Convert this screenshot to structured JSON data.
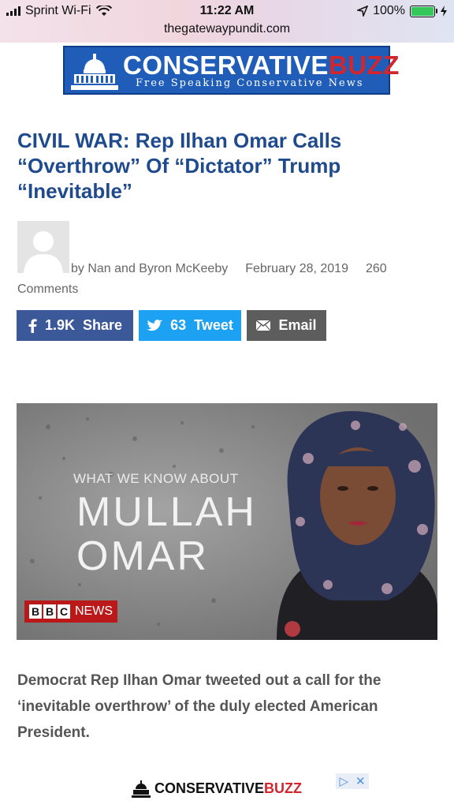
{
  "status_bar": {
    "carrier": "Sprint Wi-Fi",
    "time": "11:22 AM",
    "battery": "100%",
    "battery_level": 1.0
  },
  "url_bar": {
    "url": "thegatewaypundit.com"
  },
  "banner": {
    "title_main": "CONSERVATIVE",
    "title_accent": "BUZZ",
    "subtitle": "Free Speaking Conservative News"
  },
  "article": {
    "headline": "CIVIL WAR: Rep Ilhan Omar Calls “Overthrow” Of “Dictator” Trump “Inevitable”",
    "author": "by Nan and Byron McKeeby",
    "date": "February 28, 2019",
    "comments": "260 Comments",
    "body": "Democrat Rep Ilhan Omar tweeted out a call for the ‘inevitable overthrow’ of the duly elected American President."
  },
  "share": {
    "facebook_count": "1.9K",
    "facebook_label": "Share",
    "twitter_count": "63",
    "twitter_label": "Tweet",
    "email_label": "Email"
  },
  "image": {
    "caption_small": "WHAT WE KNOW ABOUT",
    "caption_line1": "MULLAH",
    "caption_line2": "OMAR",
    "logo_b1": "B",
    "logo_b2": "B",
    "logo_c": "C",
    "logo_news": "NEWS"
  },
  "ad": {
    "title_main": "CONSERVATIVE",
    "title_accent": "BUZZ"
  },
  "colors": {
    "headline": "#1f4b8e",
    "facebook": "#3b5998",
    "twitter": "#1da1f2",
    "email": "#5d5d5d",
    "banner": "#1f5db8",
    "accent_red": "#d2262e"
  }
}
